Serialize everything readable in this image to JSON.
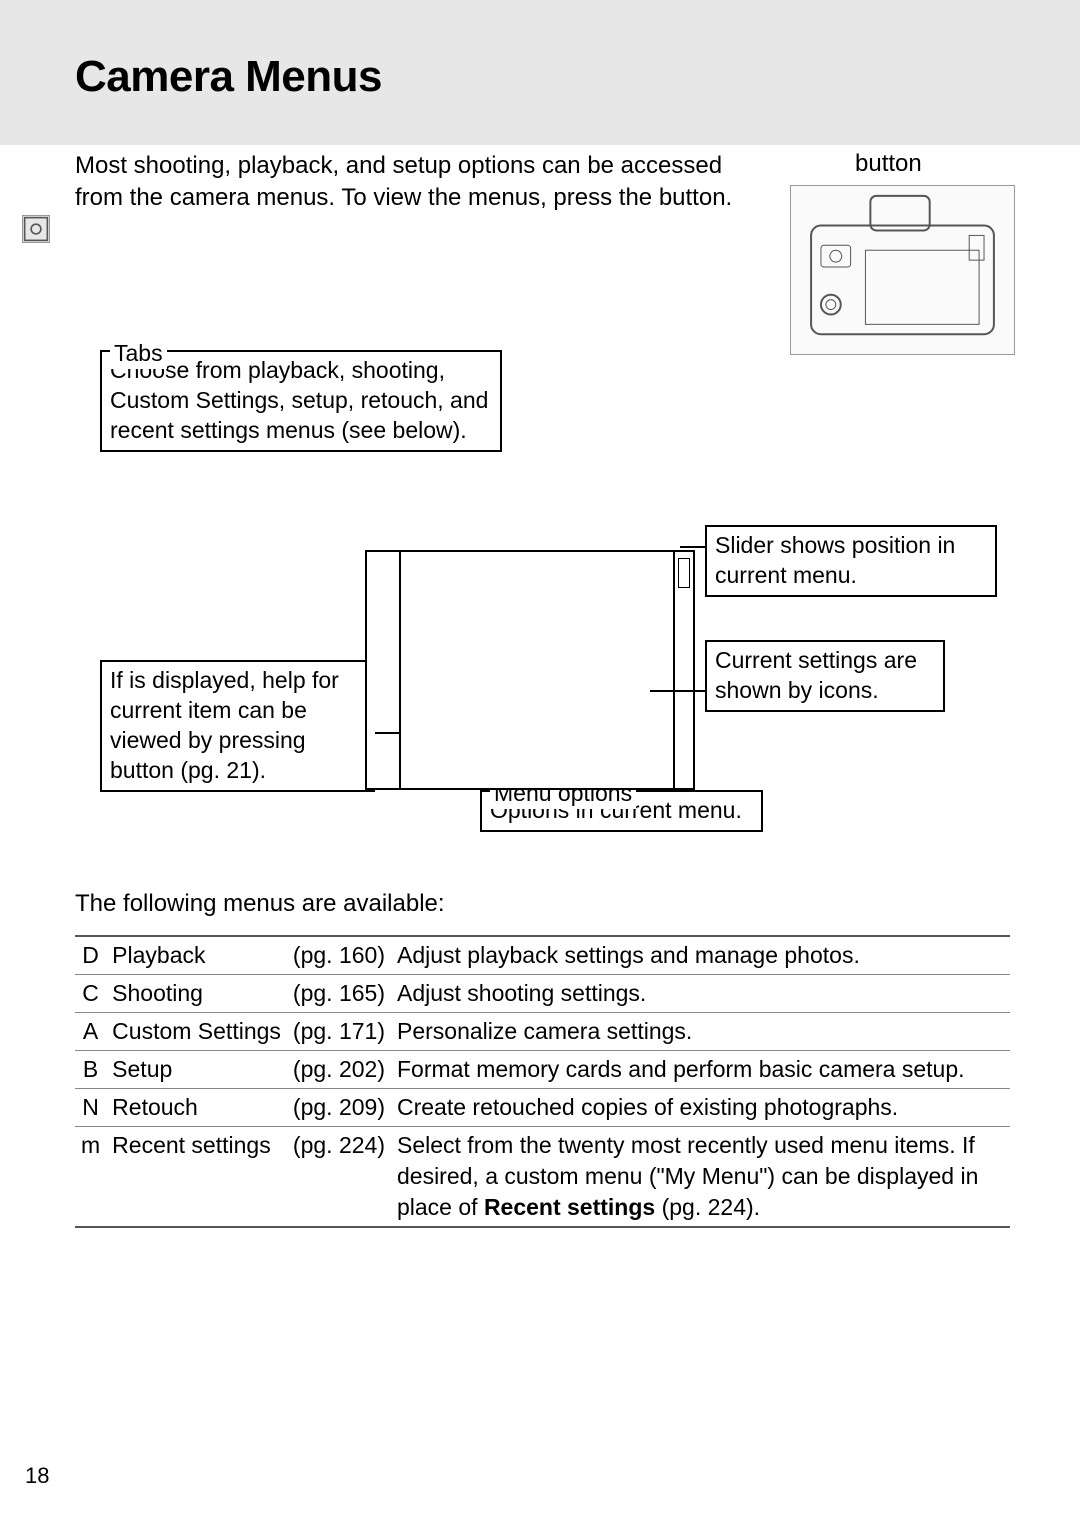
{
  "title": "Camera Menus",
  "intro": "Most shooting, playback, and setup options can be accessed from the camera menus.  To view the menus, press the button.",
  "camera_caption": "button",
  "callouts": {
    "tabs": {
      "label": "Tabs",
      "text": "Choose from playback, shooting, Custom Settings, setup, retouch, and recent settings menus (see below)."
    },
    "slider": "Slider shows position in current menu.",
    "settings": "Current settings are shown by icons.",
    "help": "If       is displayed, help for current item can be viewed by pressing       button (pg. 21).",
    "menu_options": {
      "label": "Menu options",
      "text": "Options in current menu."
    }
  },
  "following": "The following menus are available:",
  "menus": [
    {
      "icon": "D",
      "name": "Playback",
      "page": "(pg. 160)",
      "desc": "Adjust playback settings and manage photos."
    },
    {
      "icon": "C",
      "name": "Shooting",
      "page": "(pg. 165)",
      "desc": "Adjust shooting settings."
    },
    {
      "icon": "A",
      "name": "Custom Settings",
      "page": "(pg. 171)",
      "desc": "Personalize camera settings."
    },
    {
      "icon": "B",
      "name": "Setup",
      "page": "(pg. 202)",
      "desc": "Format memory cards and perform basic camera setup."
    },
    {
      "icon": "N",
      "name": "Retouch",
      "page": "(pg. 209)",
      "desc": "Create retouched copies of existing photographs."
    },
    {
      "icon": "m",
      "name": "Recent settings",
      "page": "(pg. 224)",
      "desc_pre": "Select from the twenty most recently used menu items.  If desired, a custom menu (\"My Menu\") can be displayed in place of ",
      "desc_bold": "Recent settings",
      "desc_post": " (pg. 224)."
    }
  ],
  "page_number": "18"
}
